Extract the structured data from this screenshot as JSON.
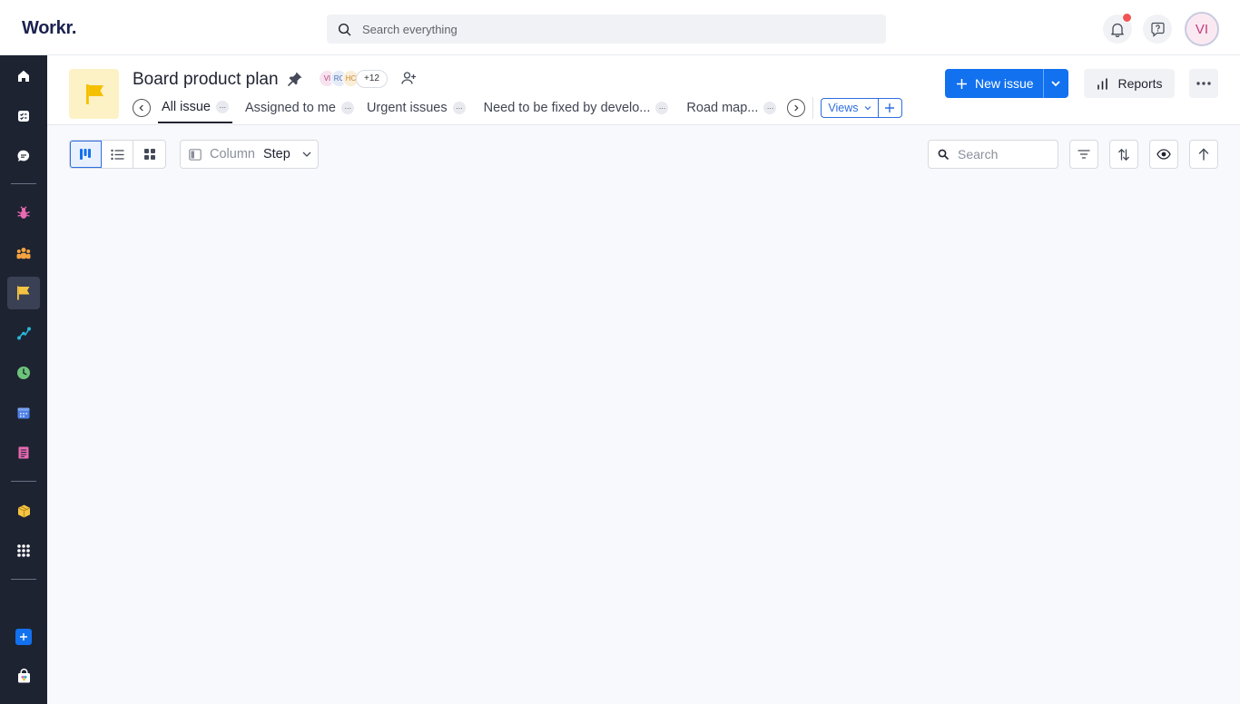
{
  "app": {
    "logo": "Workr."
  },
  "topbar": {
    "search_placeholder": "Search everything",
    "user_initials": "VI"
  },
  "project": {
    "title": "Board product plan",
    "members": [
      "VI",
      "RC",
      "HC"
    ],
    "more_members": "+12",
    "tabs": [
      {
        "label": "All issue",
        "active": true
      },
      {
        "label": "Assigned to me"
      },
      {
        "label": "Urgent issues"
      },
      {
        "label": "Need to be fixed by develo..."
      },
      {
        "label": "Road map..."
      }
    ],
    "views_label": "Views",
    "new_issue_label": "New issue",
    "reports_label": "Reports"
  },
  "toolbar": {
    "column_label": "Column",
    "column_value": "Step",
    "search_placeholder": "Search"
  },
  "colors": {
    "sidebar_bg": "#1e2332",
    "primary": "#1271ef",
    "accent_blue": "#2e6ee0",
    "notification": "#f05454"
  },
  "icons": {
    "sidebar": [
      "home-icon",
      "tasks-icon",
      "chat-icon",
      "bug-icon",
      "team-icon",
      "flag-icon",
      "roadmap-icon",
      "clock-icon",
      "calendar-icon",
      "document-icon",
      "package-icon",
      "apps-grid-icon",
      "add-icon",
      "store-icon"
    ]
  }
}
